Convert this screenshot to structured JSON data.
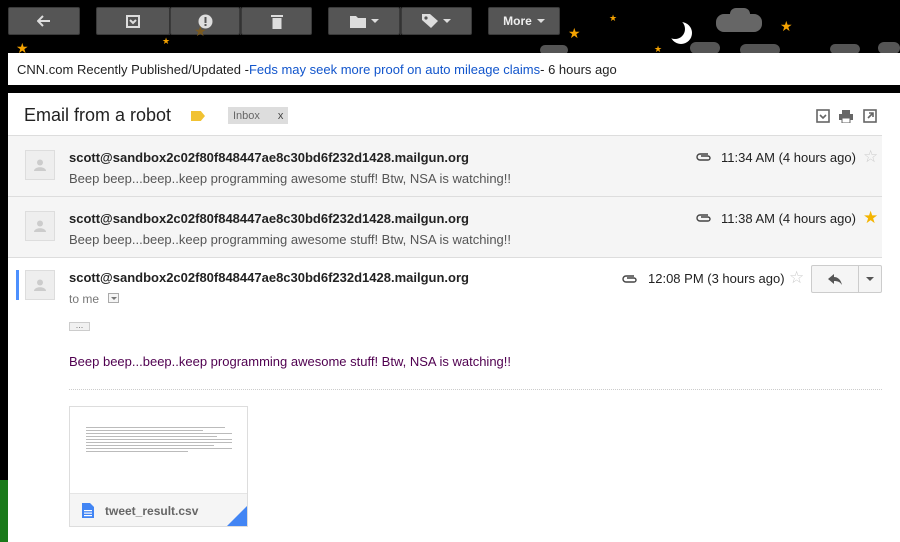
{
  "toolbar": {
    "buttons": [
      {
        "icon": "back-arrow-icon"
      },
      {
        "icon": "archive-icon"
      },
      {
        "icon": "report-spam-icon"
      },
      {
        "icon": "delete-icon"
      },
      {
        "icon": "move-to-folder-icon"
      },
      {
        "icon": "labels-icon"
      }
    ],
    "more_label": "More"
  },
  "web_clip": {
    "source": "CNN.com Recently Published/Updated - ",
    "headline": "Feds may seek more proof on auto mileage claims",
    "age": " - 6 hours ago"
  },
  "thread": {
    "subject": "Email from a robot",
    "label_color": "#f1c232",
    "inbox_chip": "Inbox",
    "inbox_chip_remove": "x",
    "messages": [
      {
        "sender": "scott@sandbox2c02f80f848447ae8c30bd6f232d1428.mailgun.org",
        "snippet": "Beep beep...beep..keep programming awesome stuff! Btw, NSA is watching!!",
        "time": "11:34 AM (4 hours ago)",
        "starred": false
      },
      {
        "sender": "scott@sandbox2c02f80f848447ae8c30bd6f232d1428.mailgun.org",
        "snippet": "Beep beep...beep..keep programming awesome stuff! Btw, NSA is watching!!",
        "time": "11:38 AM (4 hours ago)",
        "starred": true
      },
      {
        "sender": "scott@sandbox2c02f80f848447ae8c30bd6f232d1428.mailgun.org",
        "to": "to me",
        "time": "12:08 PM (3 hours ago)",
        "starred": false,
        "body": "Beep beep...beep..keep programming awesome stuff! Btw, NSA is watching!!",
        "attachment": {
          "name": "tweet_result.csv",
          "icon": "document-icon"
        }
      }
    ]
  },
  "colors": {
    "link": "#1155cc",
    "star_on": "#f4b400",
    "star_off": "#cccccc",
    "body_text": "#500050",
    "open_indicator": "#4d90fe"
  }
}
